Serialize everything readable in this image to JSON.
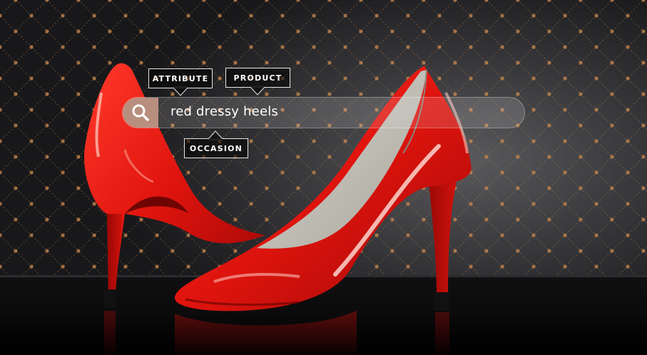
{
  "search": {
    "query": "red dressy heels"
  },
  "tags": {
    "attribute": "ATTRIBUTE",
    "product": "PRODUCT",
    "occasion": "OCCASION"
  },
  "colors": {
    "background": "#1b1b1d",
    "pattern_dot": "#c9884e",
    "shoe_red": "#e0140e",
    "search_button": "#b88f7f"
  },
  "icons": {
    "search": "magnifier-icon"
  }
}
